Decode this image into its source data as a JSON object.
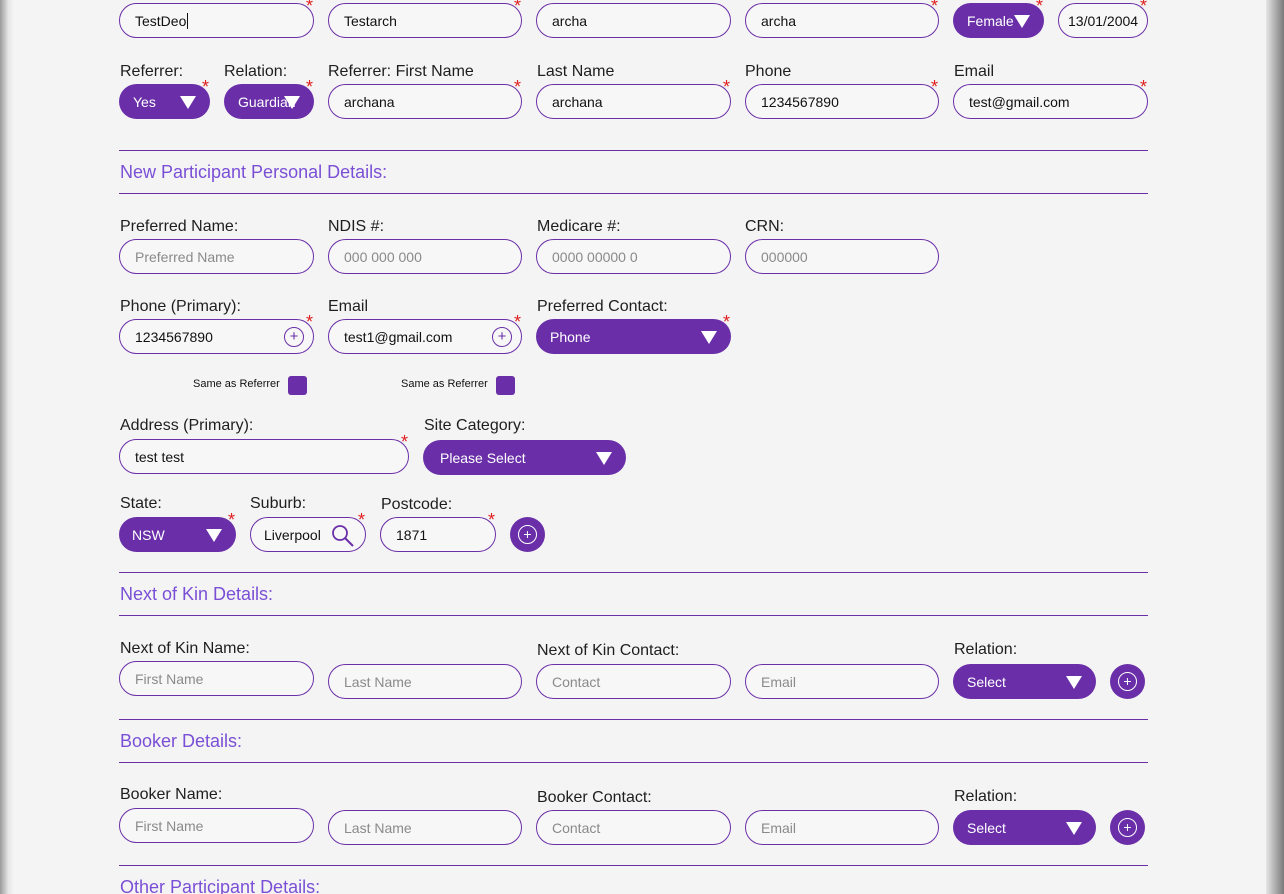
{
  "top_row": {
    "first_name": "TestDeo",
    "middle_name": "Testarch",
    "last_name": "archa",
    "preferred": "archa",
    "gender": "Female",
    "dob": "13/01/2004"
  },
  "referrer": {
    "labels": {
      "referrer": "Referrer:",
      "relation": "Relation:",
      "first_name": "Referrer: First Name",
      "last_name": "Last Name",
      "phone": "Phone",
      "email": "Email"
    },
    "referrer_value": "Yes",
    "relation_value": "Guardian",
    "first_name": "archana",
    "last_name": "archana",
    "phone": "1234567890",
    "email": "test@gmail.com"
  },
  "personal": {
    "title": "New Participant Personal Details:",
    "labels": {
      "preferred_name": "Preferred Name:",
      "ndis": "NDIS #:",
      "medicare": "Medicare #:",
      "crn": "CRN:",
      "phone_primary": "Phone (Primary):",
      "email": "Email",
      "preferred_contact": "Preferred Contact:",
      "same_as_referrer": "Same as Referrer",
      "address_primary": "Address (Primary):",
      "site_category": "Site Category:",
      "state": "State:",
      "suburb": "Suburb:",
      "postcode": "Postcode:"
    },
    "placeholders": {
      "preferred_name": "Preferred Name",
      "ndis": "000 000 000",
      "medicare": "0000 00000 0",
      "crn": "000000"
    },
    "phone_primary": "1234567890",
    "email": "test1@gmail.com",
    "preferred_contact": "Phone",
    "address": "test test",
    "site_category": "Please Select",
    "state": "NSW",
    "suburb": "Liverpool",
    "postcode": "1871"
  },
  "next_of_kin": {
    "title": "Next of Kin Details:",
    "labels": {
      "name": "Next of Kin Name:",
      "contact": "Next of Kin Contact:",
      "relation": "Relation:"
    },
    "placeholders": {
      "first_name": "First Name",
      "last_name": "Last Name",
      "contact": "Contact",
      "email": "Email"
    },
    "relation_value": "Select"
  },
  "booker": {
    "title": "Booker Details:",
    "labels": {
      "name": "Booker Name:",
      "contact": "Booker Contact:",
      "relation": "Relation:"
    },
    "placeholders": {
      "first_name": "First Name",
      "last_name": "Last Name",
      "contact": "Contact",
      "email": "Email"
    },
    "relation_value": "Select"
  },
  "other": {
    "title": "Other Participant Details:"
  },
  "colors": {
    "accent": "#6a2fa8",
    "section_title": "#7a4fd6",
    "required": "#e02020"
  }
}
